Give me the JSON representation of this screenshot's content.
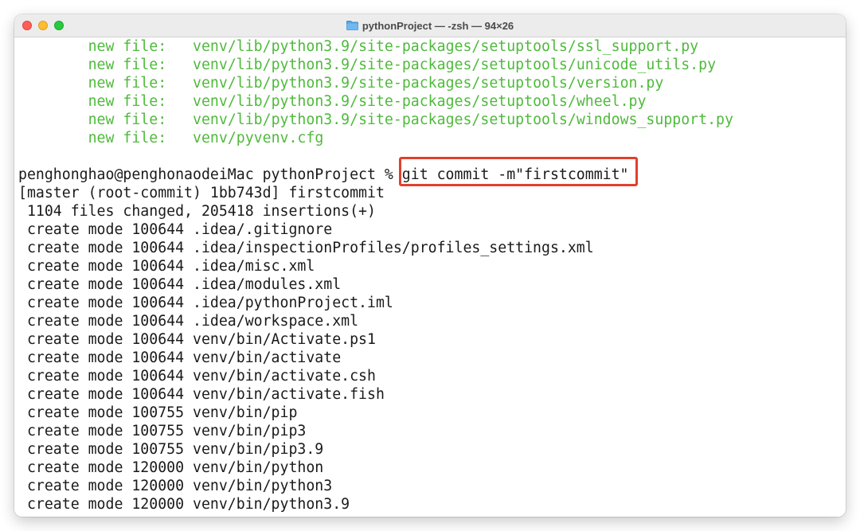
{
  "window": {
    "title": "pythonProject — -zsh — 94×26",
    "folder_icon": "folder-icon",
    "colors": {
      "close": "#ff5f57",
      "minimize": "#febc2e",
      "maximize": "#28c840",
      "staged_text": "#4fba3c",
      "highlight_border": "#e0402e"
    }
  },
  "terminal": {
    "staged_files": [
      {
        "status": "new file:",
        "path": "venv/lib/python3.9/site-packages/setuptools/ssl_support.py"
      },
      {
        "status": "new file:",
        "path": "venv/lib/python3.9/site-packages/setuptools/unicode_utils.py"
      },
      {
        "status": "new file:",
        "path": "venv/lib/python3.9/site-packages/setuptools/version.py"
      },
      {
        "status": "new file:",
        "path": "venv/lib/python3.9/site-packages/setuptools/wheel.py"
      },
      {
        "status": "new file:",
        "path": "venv/lib/python3.9/site-packages/setuptools/windows_support.py"
      },
      {
        "status": "new file:",
        "path": "venv/pyvenv.cfg"
      }
    ],
    "prompt": "penghonghao@penghonaodeiMac pythonProject % ",
    "command": "git commit -m\"firstcommit\"",
    "output": [
      "[master (root-commit) 1bb743d] firstcommit",
      " 1104 files changed, 205418 insertions(+)",
      " create mode 100644 .idea/.gitignore",
      " create mode 100644 .idea/inspectionProfiles/profiles_settings.xml",
      " create mode 100644 .idea/misc.xml",
      " create mode 100644 .idea/modules.xml",
      " create mode 100644 .idea/pythonProject.iml",
      " create mode 100644 .idea/workspace.xml",
      " create mode 100644 venv/bin/Activate.ps1",
      " create mode 100644 venv/bin/activate",
      " create mode 100644 venv/bin/activate.csh",
      " create mode 100644 venv/bin/activate.fish",
      " create mode 100755 venv/bin/pip",
      " create mode 100755 venv/bin/pip3",
      " create mode 100755 venv/bin/pip3.9",
      " create mode 120000 venv/bin/python",
      " create mode 120000 venv/bin/python3",
      " create mode 120000 venv/bin/python3.9"
    ]
  }
}
